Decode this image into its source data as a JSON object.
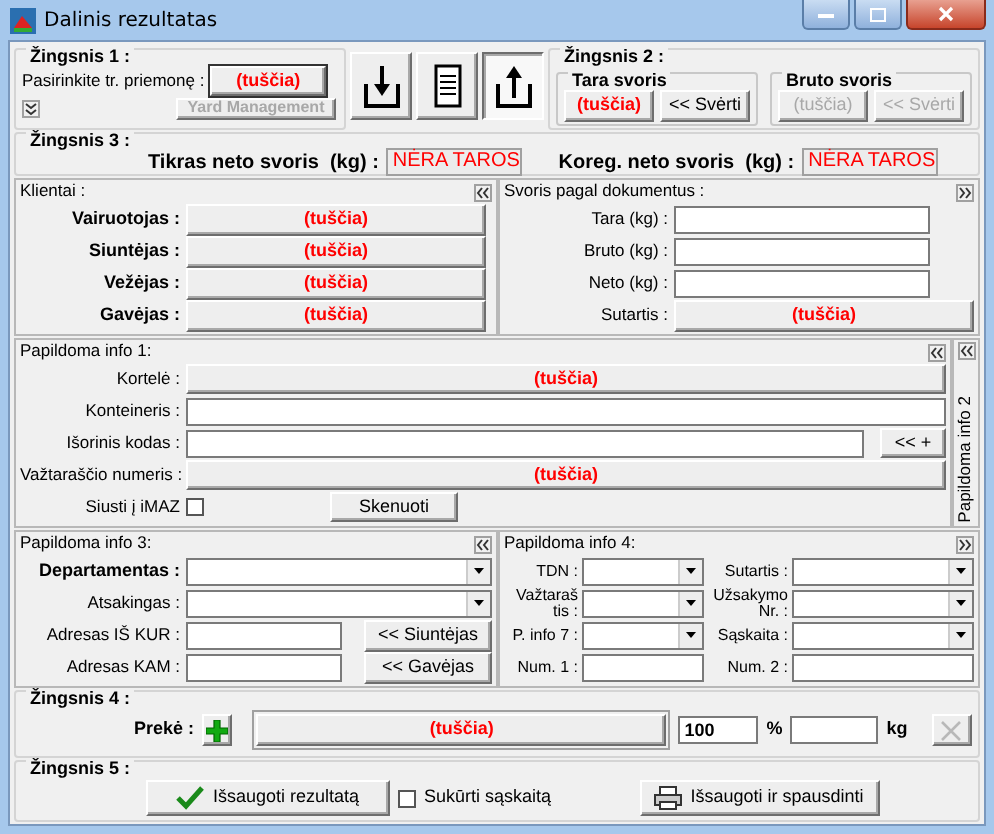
{
  "window": {
    "title": "Dalinis rezultatas"
  },
  "step1": {
    "title": "Žingsnis 1 :",
    "vehicle_label": "Pasirinkite tr. priemonę :",
    "vehicle_value": "(tuščia)",
    "yard_button": {
      "label": "Yard Management",
      "disabled": true
    }
  },
  "toolbar": [
    {
      "kind": "download",
      "pressed": false
    },
    {
      "kind": "document",
      "pressed": false
    },
    {
      "kind": "upload",
      "pressed": true
    }
  ],
  "step2": {
    "title": "Žingsnis 2 :",
    "groups": [
      {
        "title": "Tara svoris",
        "value": "(tuščia)",
        "button": "<< Svėrti",
        "disabled": false
      },
      {
        "title": "Bruto svoris",
        "value": "(tuščia)",
        "button": "<< Svėrti",
        "disabled": true
      }
    ]
  },
  "step3": {
    "title": "Žingsnis 3 :",
    "fields": [
      {
        "label": "Tikras neto svoris  (kg) :",
        "value": "NĖRA TAROS"
      },
      {
        "label": "Koreg. neto svoris  (kg) :",
        "value": "NĖRA TAROS"
      }
    ]
  },
  "clients": {
    "title": "Klientai :",
    "rows": [
      {
        "label": "Vairuotojas :",
        "value": "(tuščia)"
      },
      {
        "label": "Siuntėjas :",
        "value": "(tuščia)"
      },
      {
        "label": "Vežėjas :",
        "value": "(tuščia)"
      },
      {
        "label": "Gavėjas :",
        "value": "(tuščia)"
      }
    ]
  },
  "documents": {
    "title": "Svoris pagal dokumentus :",
    "fields": [
      {
        "label": "Tara (kg) :"
      },
      {
        "label": "Bruto (kg) :"
      },
      {
        "label": "Neto (kg) :"
      }
    ],
    "contract": {
      "label": "Sutartis :",
      "value": "(tuščia)"
    }
  },
  "info1": {
    "title": "Papildoma info 1:",
    "rows": [
      {
        "kind": "button",
        "label": "Kortelė :",
        "value": "(tuščia)"
      },
      {
        "kind": "input",
        "label": "Konteineris :"
      },
      {
        "kind": "input_button",
        "label": "Išorinis kodas :",
        "button": "<< +"
      },
      {
        "kind": "button",
        "label": "Važtaraščio numeris :",
        "value": "(tuščia)"
      },
      {
        "kind": "checkbox",
        "label": "Siusti į iMAZ",
        "checked": false,
        "button": "Skenuoti"
      }
    ]
  },
  "info2": {
    "title": "Papildoma info 2"
  },
  "info3": {
    "title": "Papildoma info 3:",
    "rows": [
      {
        "kind": "combo",
        "label": "Departamentas :",
        "bold": true
      },
      {
        "kind": "combo",
        "label": "Atsakingas :",
        "bold": false
      },
      {
        "kind": "input_button",
        "label": "Adresas IŠ KUR :",
        "bold": false,
        "button": "<< Siuntėjas"
      },
      {
        "kind": "input_button",
        "label": "Adresas KAM :",
        "bold": false,
        "button": "<< Gavėjas"
      }
    ]
  },
  "info4": {
    "title": "Papildoma info 4:",
    "fields": [
      {
        "kind": "combo",
        "label": "TDN :"
      },
      {
        "kind": "combo",
        "label": "Sutartis :"
      },
      {
        "kind": "combo",
        "label": "Važtaraš tis :"
      },
      {
        "kind": "combo",
        "label": "Užsakymo Nr. :"
      },
      {
        "kind": "combo",
        "label": "P. info 7 :"
      },
      {
        "kind": "combo",
        "label": "Sąskaita :"
      },
      {
        "kind": "input",
        "label": "Num. 1 :"
      },
      {
        "kind": "input",
        "label": "Num. 2 :"
      }
    ]
  },
  "step4": {
    "title": "Žingsnis 4 :",
    "label": "Prekė :",
    "value": "(tuščia)",
    "percent": "100",
    "percent_unit": "%",
    "kg_unit": "kg",
    "delete_disabled": true
  },
  "step5": {
    "title": "Žingsnis 5 :",
    "save": "Išsaugoti rezultatą",
    "invoice": {
      "label": "Sukūrti sąskaitą",
      "checked": false
    },
    "print": "Išsaugoti ir spausdinti"
  }
}
